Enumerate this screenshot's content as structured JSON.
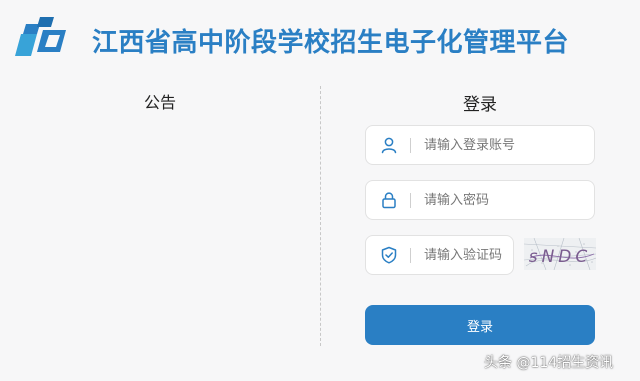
{
  "header": {
    "title": "江西省高中阶段学校招生电子化管理平台",
    "logo_icon": "platform-logo-icon"
  },
  "notice": {
    "title": "公告"
  },
  "login": {
    "title": "登录",
    "account": {
      "placeholder": "请输入登录账号",
      "value": "",
      "icon": "user-icon"
    },
    "password": {
      "placeholder": "请输入密码",
      "value": "",
      "icon": "lock-icon"
    },
    "captcha": {
      "placeholder": "请输入验证码",
      "value": "",
      "icon": "shield-icon",
      "image_text": "sNDC"
    },
    "submit_label": "登录"
  },
  "watermark": "头条 @114招生资讯",
  "colors": {
    "brand": "#2a7fc4",
    "background": "#f7f7f8"
  }
}
